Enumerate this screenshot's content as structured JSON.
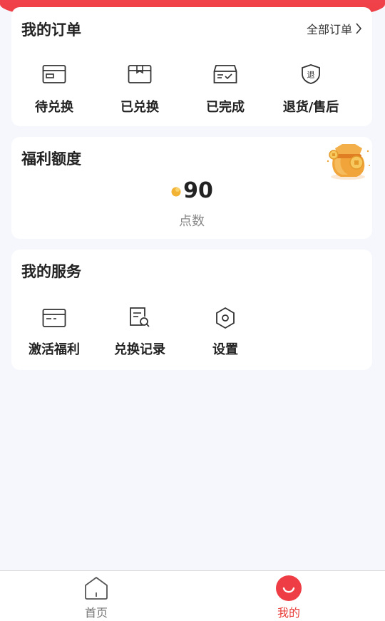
{
  "colors": {
    "accent": "#ee3d44",
    "page_bg": "#f5f7fc",
    "coin": "#f2b233"
  },
  "orders": {
    "title": "我的订单",
    "all_link": "全部订单",
    "items": [
      {
        "label": "待兑换",
        "icon": "card-icon"
      },
      {
        "label": "已兑换",
        "icon": "box-icon"
      },
      {
        "label": "已完成",
        "icon": "inbox-check-icon"
      },
      {
        "label": "退货/售后",
        "icon": "return-shield-icon",
        "icon_text": "退"
      }
    ]
  },
  "welfare": {
    "title": "福利额度",
    "points_value": "90",
    "points_label": "点数",
    "icons": [
      "coin-icon",
      "money-bag-icon"
    ]
  },
  "services": {
    "title": "我的服务",
    "items": [
      {
        "label": "激活福利",
        "icon": "card-icon"
      },
      {
        "label": "兑换记录",
        "icon": "record-search-icon"
      },
      {
        "label": "设置",
        "icon": "settings-hexagon-icon"
      }
    ]
  },
  "bottom_nav": {
    "items": [
      {
        "label": "首页",
        "icon": "home-icon",
        "active": false
      },
      {
        "label": "我的",
        "icon": "smile-icon",
        "active": true
      }
    ]
  }
}
